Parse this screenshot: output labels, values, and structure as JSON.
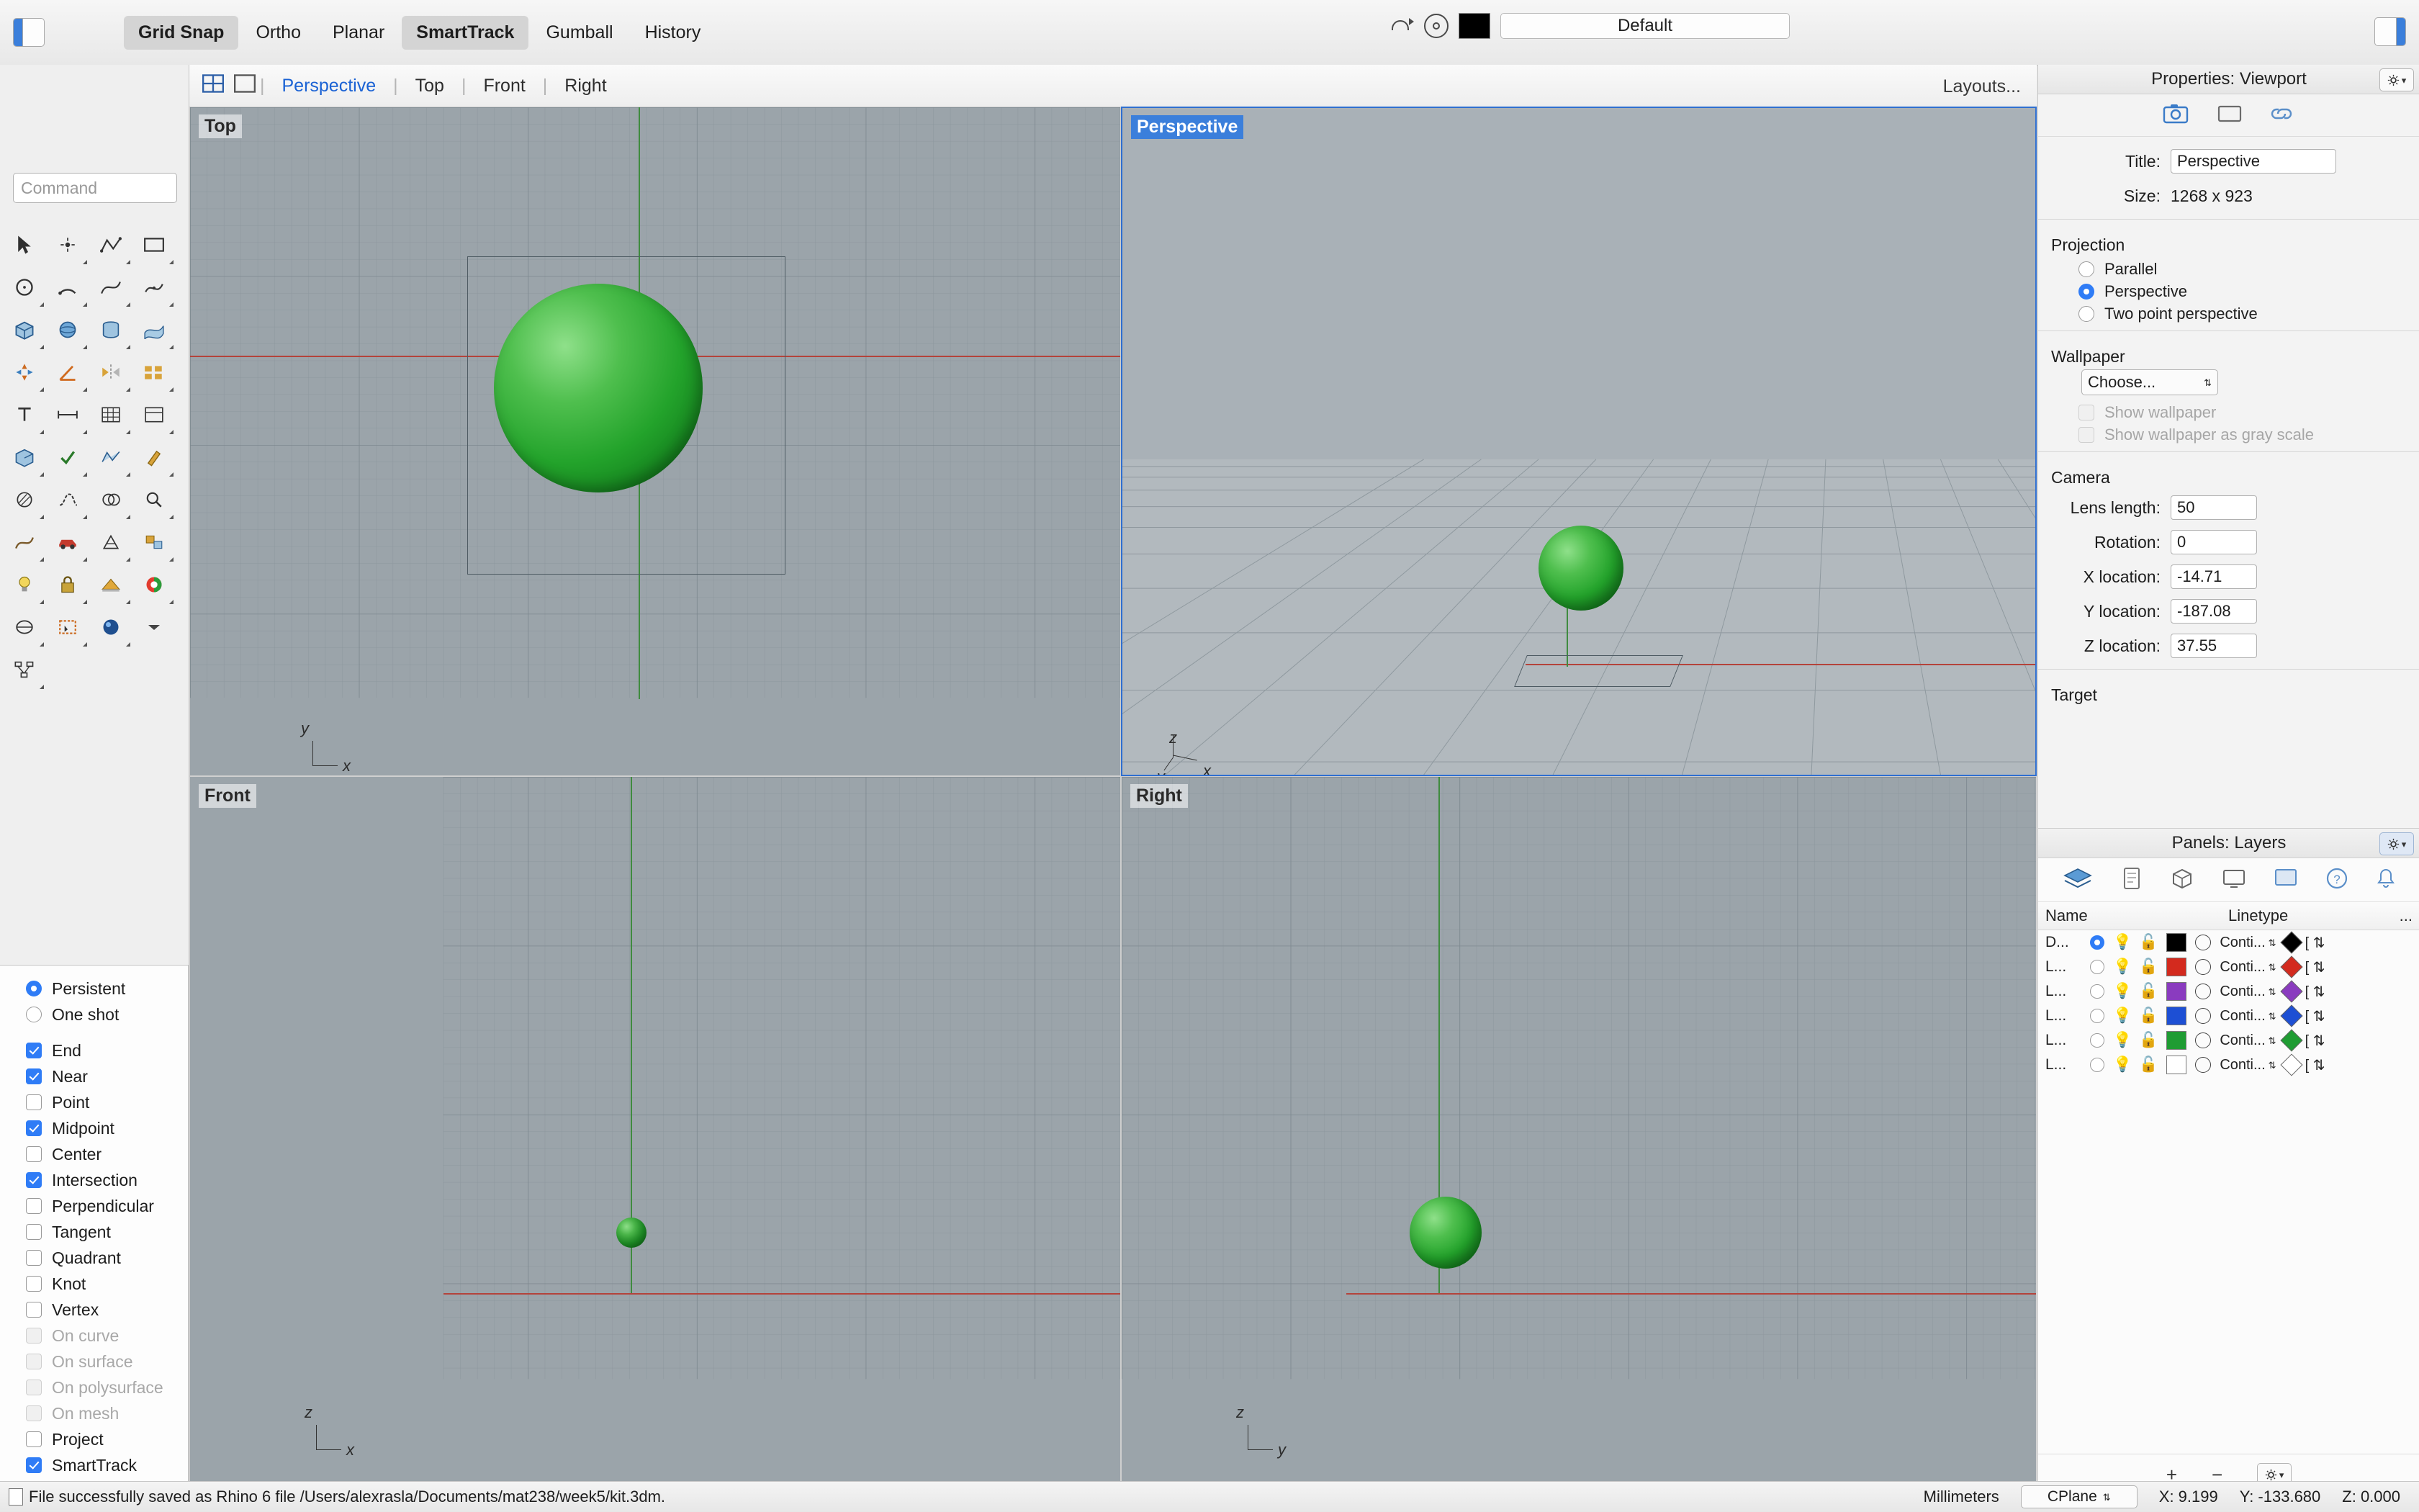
{
  "toolbar": {
    "buttons": [
      {
        "label": "Grid Snap",
        "active": true,
        "bold": true
      },
      {
        "label": "Ortho",
        "active": false,
        "bold": false
      },
      {
        "label": "Planar",
        "active": false,
        "bold": false
      },
      {
        "label": "SmartTrack",
        "active": true,
        "bold": true
      },
      {
        "label": "Gumball",
        "active": false,
        "bold": false
      },
      {
        "label": "History",
        "active": false,
        "bold": false
      }
    ],
    "layer_value": "Default",
    "left_panel_icon": "left-sidebar-toggle-icon",
    "right_panel_icon": "right-sidebar-toggle-icon",
    "arrow_icon": "undo-arrow-icon",
    "circle_icon": "record-circle-icon",
    "color_swatch": "#000000"
  },
  "command": {
    "placeholder": "Command"
  },
  "viewport_tabs": {
    "items": [
      "Perspective",
      "Top",
      "Front",
      "Right"
    ],
    "active": "Perspective",
    "layouts_label": "Layouts...",
    "four_view_icon": "four-view-layout-icon",
    "single_view_icon": "single-view-layout-icon"
  },
  "viewports": [
    {
      "name": "Top",
      "selected": false
    },
    {
      "name": "Perspective",
      "selected": true
    },
    {
      "name": "Front",
      "selected": false
    },
    {
      "name": "Right",
      "selected": false
    }
  ],
  "osnap": {
    "modes": [
      {
        "label": "Persistent",
        "type": "radio",
        "checked": true,
        "dim": false
      },
      {
        "label": "One shot",
        "type": "radio",
        "checked": false,
        "dim": false
      }
    ],
    "snaps": [
      {
        "label": "End",
        "checked": true,
        "dim": false
      },
      {
        "label": "Near",
        "checked": true,
        "dim": false
      },
      {
        "label": "Point",
        "checked": false,
        "dim": false
      },
      {
        "label": "Midpoint",
        "checked": true,
        "dim": false
      },
      {
        "label": "Center",
        "checked": false,
        "dim": false
      },
      {
        "label": "Intersection",
        "checked": true,
        "dim": false
      },
      {
        "label": "Perpendicular",
        "checked": false,
        "dim": false
      },
      {
        "label": "Tangent",
        "checked": false,
        "dim": false
      },
      {
        "label": "Quadrant",
        "checked": false,
        "dim": false
      },
      {
        "label": "Knot",
        "checked": false,
        "dim": false
      },
      {
        "label": "Vertex",
        "checked": false,
        "dim": false
      },
      {
        "label": "On curve",
        "checked": false,
        "dim": true
      },
      {
        "label": "On surface",
        "checked": false,
        "dim": true
      },
      {
        "label": "On polysurface",
        "checked": false,
        "dim": true
      },
      {
        "label": "On mesh",
        "checked": false,
        "dim": true
      },
      {
        "label": "Project",
        "checked": false,
        "dim": false
      },
      {
        "label": "SmartTrack",
        "checked": true,
        "dim": false
      }
    ]
  },
  "properties": {
    "panel_title": "Properties: Viewport",
    "tabs": [
      "camera-icon",
      "display-icon",
      "link-icon"
    ],
    "title_label": "Title:",
    "title_value": "Perspective",
    "size_label": "Size:",
    "size_value": "1268 x 923",
    "projection_label": "Projection",
    "projection_options": [
      {
        "label": "Parallel",
        "checked": false
      },
      {
        "label": "Perspective",
        "checked": true
      },
      {
        "label": "Two point perspective",
        "checked": false
      }
    ],
    "wallpaper_label": "Wallpaper",
    "wallpaper_choose": "Choose...",
    "wallpaper_options": [
      {
        "label": "Show wallpaper",
        "checked": false
      },
      {
        "label": "Show wallpaper as gray scale",
        "checked": false
      }
    ],
    "camera_label": "Camera",
    "camera_fields": [
      {
        "label": "Lens length:",
        "value": "50"
      },
      {
        "label": "Rotation:",
        "value": "0"
      },
      {
        "label": "X location:",
        "value": "-14.71"
      },
      {
        "label": "Y location:",
        "value": "-187.08"
      },
      {
        "label": "Z location:",
        "value": "37.55"
      }
    ],
    "target_label": "Target"
  },
  "layers": {
    "panel_title": "Panels: Layers",
    "tab_icons": [
      "layers-icon",
      "properties-icon",
      "objects-icon",
      "display-icon",
      "viewport-icon",
      "help-icon",
      "notifications-icon"
    ],
    "columns": [
      "Name",
      "Linetype",
      "..."
    ],
    "rows": [
      {
        "name": "D...",
        "current": true,
        "color": "#000000",
        "linetype": "Conti...",
        "print_color": "#000000"
      },
      {
        "name": "L...",
        "current": false,
        "color": "#d32a1e",
        "linetype": "Conti...",
        "print_color": "#d32a1e"
      },
      {
        "name": "L...",
        "current": false,
        "color": "#8a3bbf",
        "linetype": "Conti...",
        "print_color": "#8a3bbf"
      },
      {
        "name": "L...",
        "current": false,
        "color": "#1d4fd4",
        "linetype": "Conti...",
        "print_color": "#1d4fd4"
      },
      {
        "name": "L...",
        "current": false,
        "color": "#1f9c33",
        "linetype": "Conti...",
        "print_color": "#1f9c33"
      },
      {
        "name": "L...",
        "current": false,
        "color": "#ffffff",
        "linetype": "Conti...",
        "print_color": "#ffffff"
      }
    ],
    "footer": {
      "add": "+",
      "remove": "−",
      "gear": "gear-icon"
    }
  },
  "status": {
    "message": "File successfully saved as Rhino 6 file /Users/alexrasla/Documents/mat238/week5/kit.3dm.",
    "units": "Millimeters",
    "cplane": "CPlane",
    "x": "X: 9.199",
    "y": "Y: -133.680",
    "z": "Z: 0.000"
  }
}
